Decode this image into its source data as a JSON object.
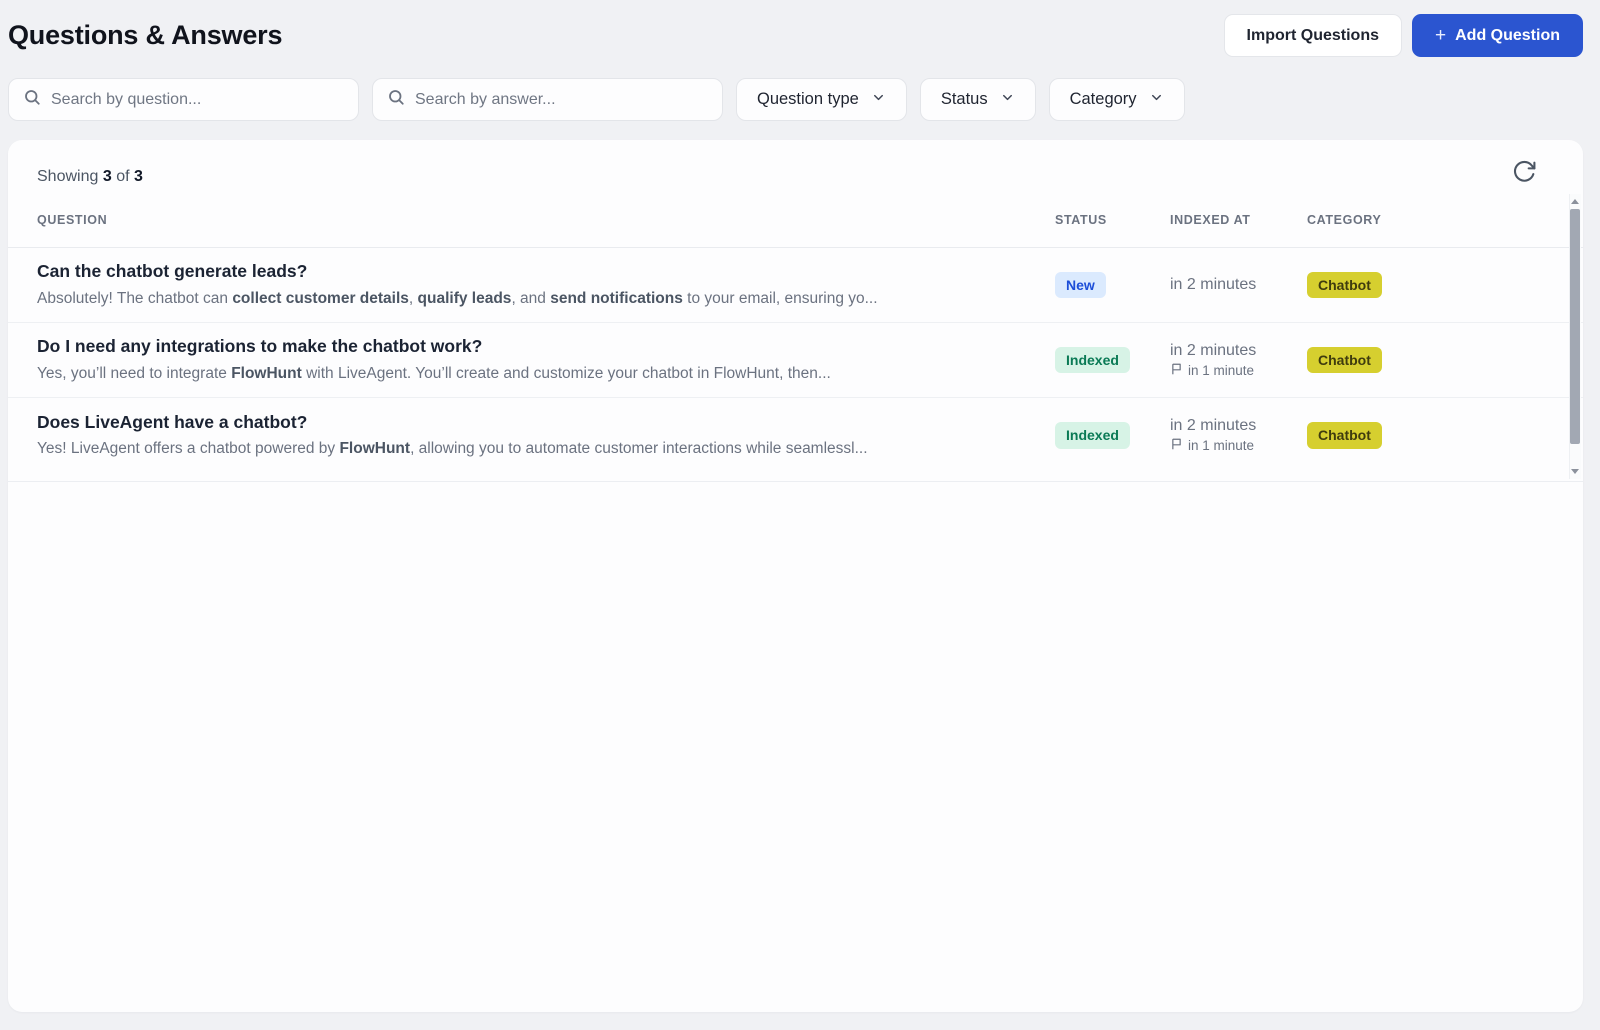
{
  "page": {
    "title": "Questions & Answers"
  },
  "colors": {
    "accent_blue": "#2b55d0",
    "page_background": "#f0f1f4",
    "status_new_bg": "#dbeafe",
    "status_new_fg": "#1d4ed8",
    "status_indexed_bg": "#d7f3e6",
    "status_indexed_fg": "#0a7a55",
    "category_chatbot_bg": "#d6cf2f",
    "category_chatbot_fg": "#3f3c0e"
  },
  "icons": {
    "search": "magnifier",
    "chevron": "chevron-down",
    "plus": "+",
    "refresh": "rotate-clockwise-arrow",
    "flag": "flag-outline"
  },
  "header": {
    "import_button": "Import Questions",
    "add_button": "Add Question",
    "add_icon": "+"
  },
  "filters": {
    "search_question_placeholder": "Search by question...",
    "search_answer_placeholder": "Search by answer...",
    "dropdowns": [
      {
        "label": "Question type"
      },
      {
        "label": "Status"
      },
      {
        "label": "Category"
      }
    ]
  },
  "table": {
    "showing_label": "Showing",
    "showing_count": "3",
    "of_label": "of",
    "total_count": "3",
    "columns": [
      "Question",
      "Status",
      "Indexed at",
      "Category"
    ],
    "rows": [
      {
        "question": "Can the chatbot generate leads?",
        "answer_parts": [
          {
            "text": "Absolutely! The chatbot can ",
            "bold": false
          },
          {
            "text": "collect customer details",
            "bold": true
          },
          {
            "text": ", ",
            "bold": false
          },
          {
            "text": "qualify leads",
            "bold": true
          },
          {
            "text": ", and ",
            "bold": false
          },
          {
            "text": "send notifications",
            "bold": true
          },
          {
            "text": " to your email, ensuring yo...",
            "bold": false
          }
        ],
        "status": {
          "label": "New",
          "bg": "#dbeafe",
          "fg": "#1d4ed8"
        },
        "indexed_primary": "in 2 minutes",
        "indexed_secondary": null,
        "category": {
          "label": "Chatbot",
          "bg": "#d6cf2f",
          "fg": "#3f3c0e"
        }
      },
      {
        "question": "Do I need any integrations to make the chatbot work?",
        "answer_parts": [
          {
            "text": "Yes, you’ll need to integrate ",
            "bold": false
          },
          {
            "text": "FlowHunt",
            "bold": true
          },
          {
            "text": " with LiveAgent. You’ll create and customize your chatbot in FlowHunt, then...",
            "bold": false
          }
        ],
        "status": {
          "label": "Indexed",
          "bg": "#d7f3e6",
          "fg": "#0a7a55"
        },
        "indexed_primary": "in 2 minutes",
        "indexed_secondary": "in 1 minute",
        "category": {
          "label": "Chatbot",
          "bg": "#d6cf2f",
          "fg": "#3f3c0e"
        }
      },
      {
        "question": "Does LiveAgent have a chatbot?",
        "answer_parts": [
          {
            "text": "Yes! LiveAgent offers a chatbot powered by ",
            "bold": false
          },
          {
            "text": "FlowHunt",
            "bold": true
          },
          {
            "text": ", allowing you to automate customer interactions while seamlessl...",
            "bold": false
          }
        ],
        "status": {
          "label": "Indexed",
          "bg": "#d7f3e6",
          "fg": "#0a7a55"
        },
        "indexed_primary": "in 2 minutes",
        "indexed_secondary": "in 1 minute",
        "category": {
          "label": "Chatbot",
          "bg": "#d6cf2f",
          "fg": "#3f3c0e"
        }
      }
    ]
  }
}
